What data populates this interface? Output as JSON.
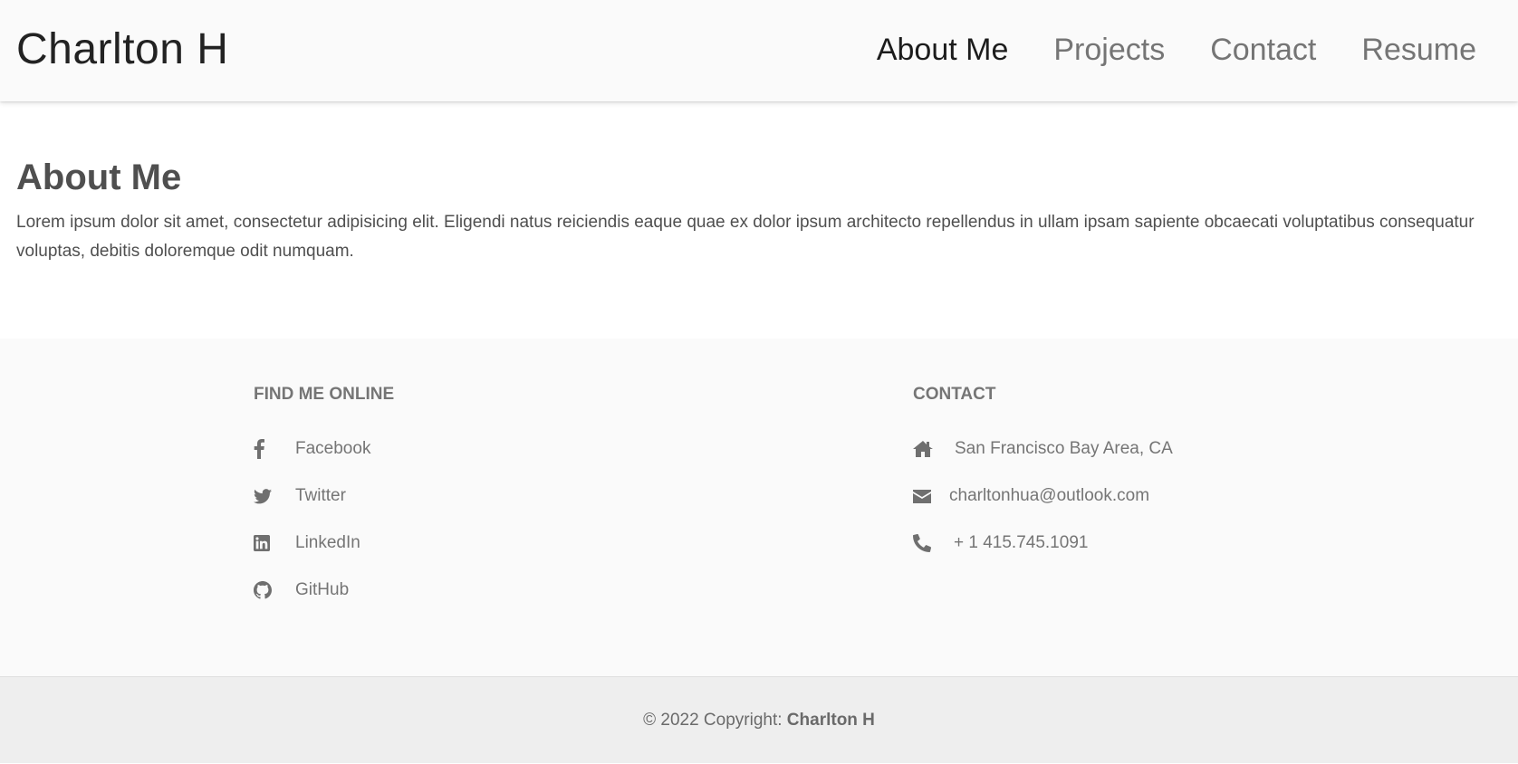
{
  "navbar": {
    "brand": "Charlton H",
    "links": [
      {
        "label": "About Me",
        "active": true
      },
      {
        "label": "Projects",
        "active": false
      },
      {
        "label": "Contact",
        "active": false
      },
      {
        "label": "Resume",
        "active": false
      }
    ]
  },
  "about": {
    "heading": "About Me",
    "body": "Lorem ipsum dolor sit amet, consectetur adipisicing elit. Eligendi natus reiciendis eaque quae ex dolor ipsum architecto repellendus in ullam ipsam sapiente obcaecati voluptatibus consequatur voluptas, debitis doloremque odit numquam."
  },
  "footer": {
    "online": {
      "heading": "Find me online",
      "items": [
        {
          "icon": "facebook-icon",
          "label": "Facebook"
        },
        {
          "icon": "twitter-icon",
          "label": "Twitter"
        },
        {
          "icon": "linkedin-icon",
          "label": "LinkedIn"
        },
        {
          "icon": "github-icon",
          "label": "GitHub"
        }
      ]
    },
    "contact": {
      "heading": "Contact",
      "items": [
        {
          "icon": "home-icon",
          "label": "San Francisco Bay Area, CA"
        },
        {
          "icon": "envelope-icon",
          "label": "charltonhua@outlook.com"
        },
        {
          "icon": "phone-icon",
          "label": "+ 1 415.745.1091"
        }
      ]
    }
  },
  "copyright": {
    "prefix": "© 2022 Copyright: ",
    "name": "Charlton H"
  },
  "colors": {
    "navbar_bg": "#fafafa",
    "footer_bg": "#fafafa",
    "copyright_bg": "#eeeeee",
    "text": "#4f4f4f",
    "muted": "#757575"
  }
}
